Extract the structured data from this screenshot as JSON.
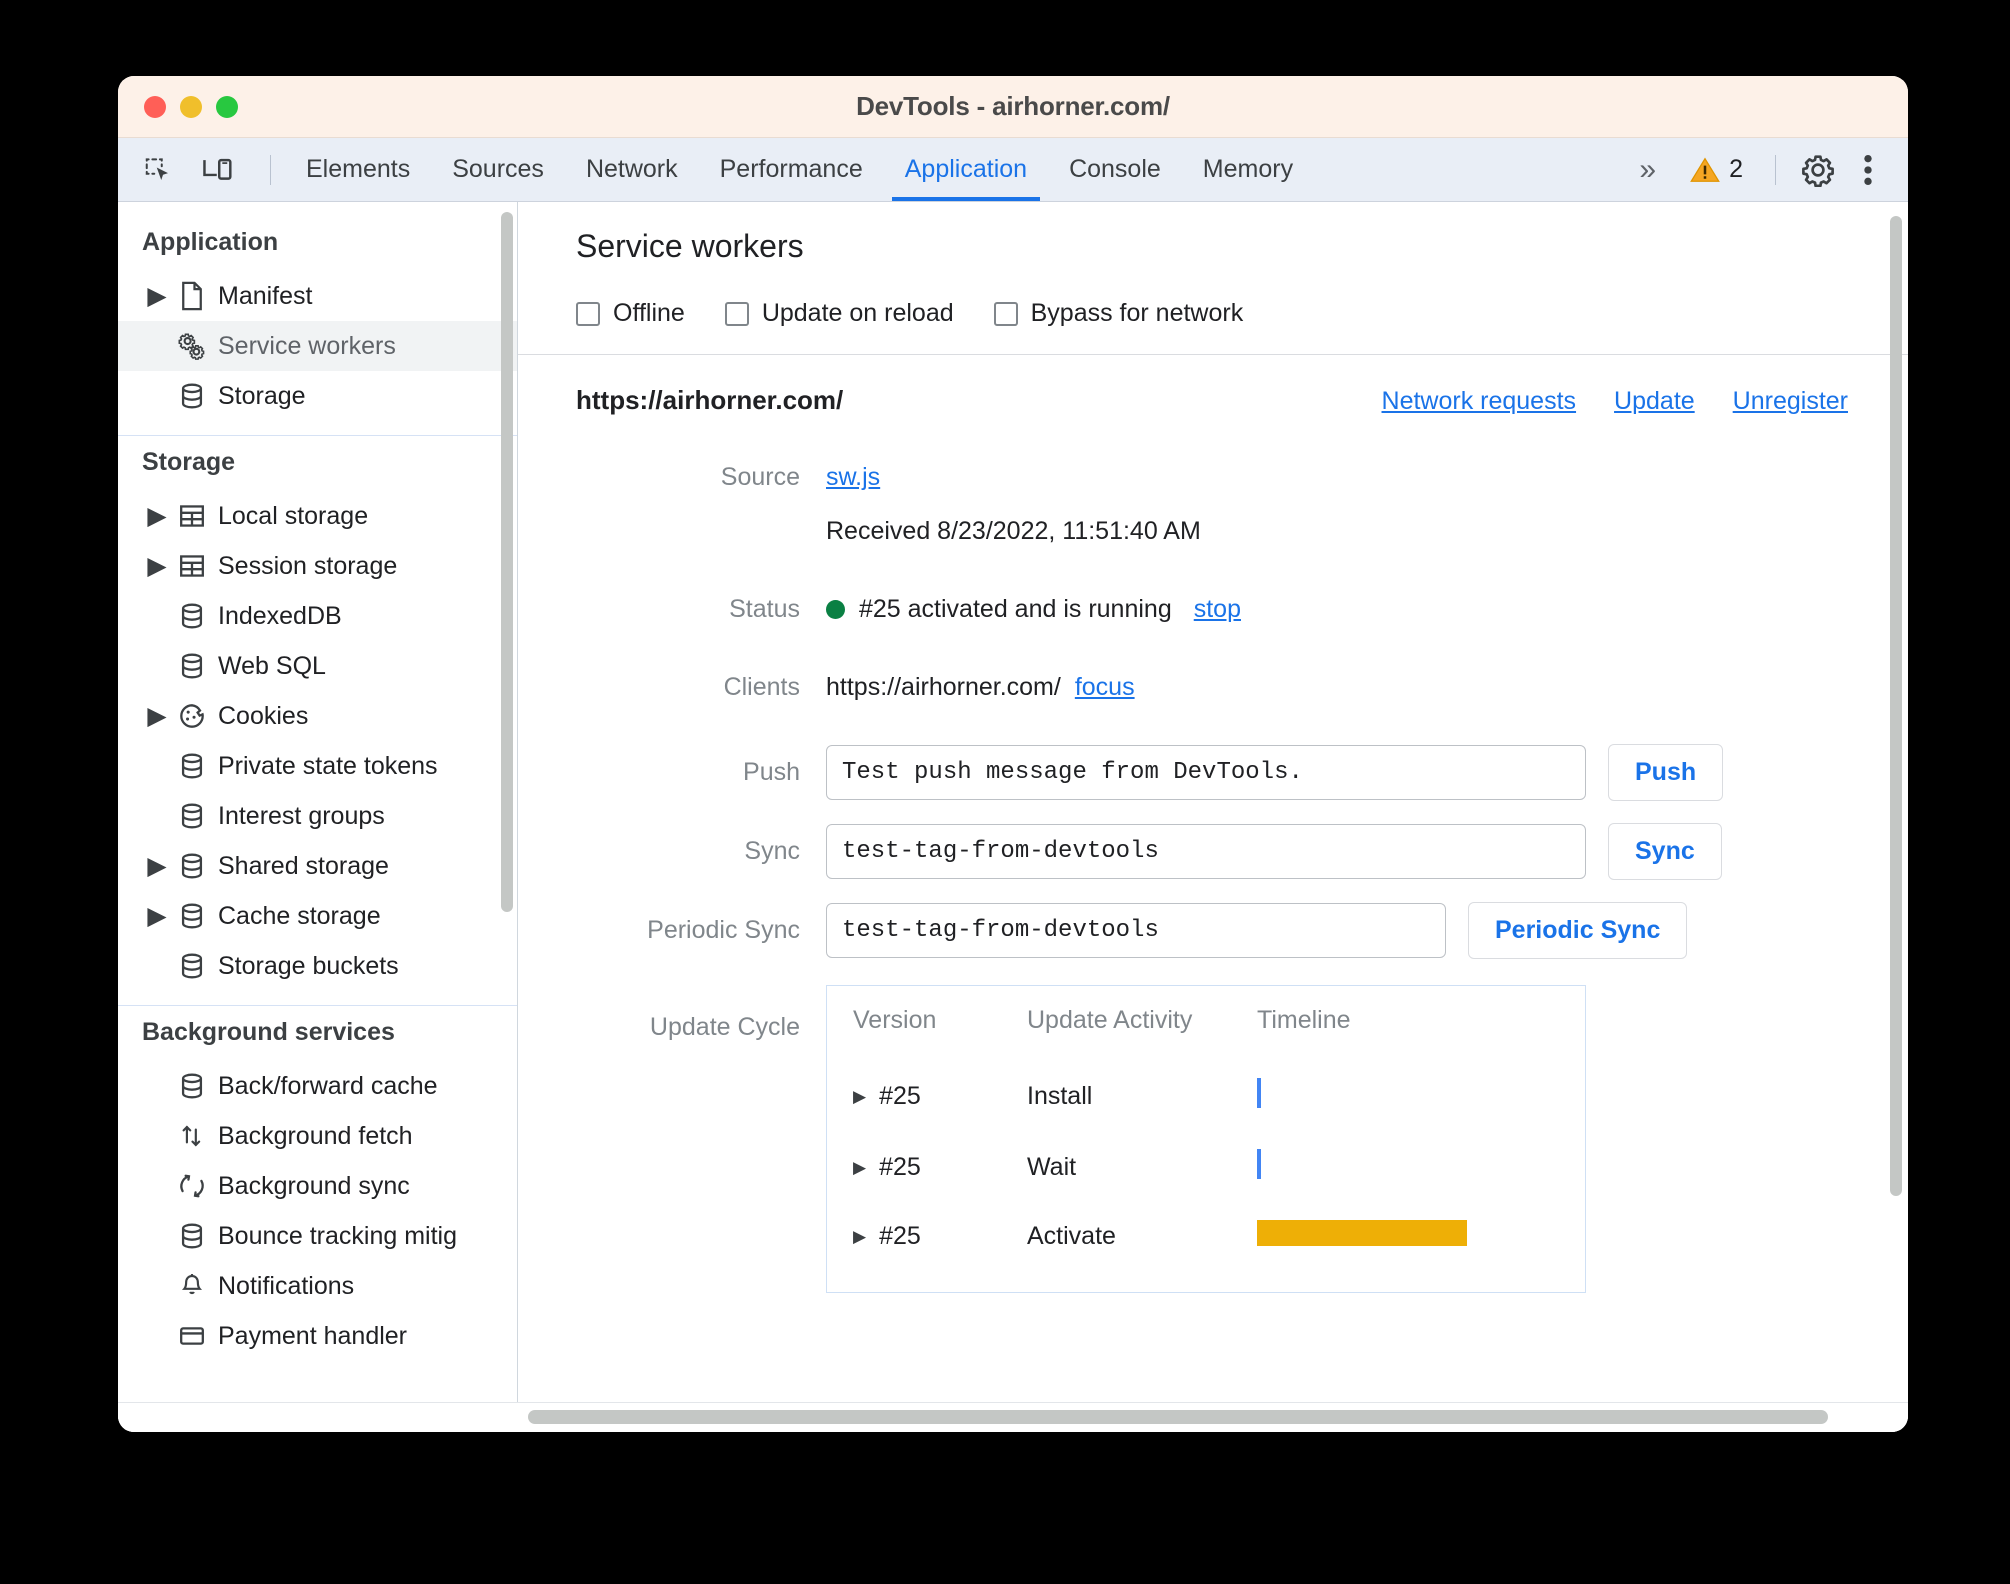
{
  "window": {
    "title": "DevTools - airhorner.com/",
    "traffic_lights": [
      "close-red",
      "minimize-yellow",
      "maximize-green"
    ]
  },
  "toolbar": {
    "inspect_icon": "inspect-element-icon",
    "device_icon": "device-toolbar-icon",
    "tabs": [
      {
        "label": "Elements",
        "active": false
      },
      {
        "label": "Sources",
        "active": false
      },
      {
        "label": "Network",
        "active": false
      },
      {
        "label": "Performance",
        "active": false
      },
      {
        "label": "Application",
        "active": true
      },
      {
        "label": "Console",
        "active": false
      },
      {
        "label": "Memory",
        "active": false
      }
    ],
    "more_tabs": "»",
    "warning_icon": "warning-triangle-icon",
    "warning_count": "2",
    "settings_icon": "gear-icon",
    "menu_icon": "vertical-dots-icon"
  },
  "sidebar": {
    "groups": [
      {
        "title": "Application",
        "items": [
          {
            "label": "Manifest",
            "icon": "document-icon",
            "arrow": true,
            "selected": false
          },
          {
            "label": "Service workers",
            "icon": "gears-icon",
            "arrow": false,
            "selected": true
          },
          {
            "label": "Storage",
            "icon": "database-icon",
            "arrow": false,
            "selected": false
          }
        ]
      },
      {
        "title": "Storage",
        "items": [
          {
            "label": "Local storage",
            "icon": "table-icon",
            "arrow": true,
            "selected": false
          },
          {
            "label": "Session storage",
            "icon": "table-icon",
            "arrow": true,
            "selected": false
          },
          {
            "label": "IndexedDB",
            "icon": "database-icon",
            "arrow": false,
            "selected": false
          },
          {
            "label": "Web SQL",
            "icon": "database-icon",
            "arrow": false,
            "selected": false
          },
          {
            "label": "Cookies",
            "icon": "cookie-icon",
            "arrow": true,
            "selected": false
          },
          {
            "label": "Private state tokens",
            "icon": "database-icon",
            "arrow": false,
            "selected": false
          },
          {
            "label": "Interest groups",
            "icon": "database-icon",
            "arrow": false,
            "selected": false
          },
          {
            "label": "Shared storage",
            "icon": "database-icon",
            "arrow": true,
            "selected": false
          },
          {
            "label": "Cache storage",
            "icon": "database-icon",
            "arrow": true,
            "selected": false
          },
          {
            "label": "Storage buckets",
            "icon": "database-icon",
            "arrow": false,
            "selected": false
          }
        ]
      },
      {
        "title": "Background services",
        "items": [
          {
            "label": "Back/forward cache",
            "icon": "database-icon",
            "arrow": false,
            "selected": false
          },
          {
            "label": "Background fetch",
            "icon": "updown-arrows-icon",
            "arrow": false,
            "selected": false
          },
          {
            "label": "Background sync",
            "icon": "sync-arrows-icon",
            "arrow": false,
            "selected": false
          },
          {
            "label": "Bounce tracking mitig",
            "icon": "database-icon",
            "arrow": false,
            "selected": false
          },
          {
            "label": "Notifications",
            "icon": "bell-icon",
            "arrow": false,
            "selected": false
          },
          {
            "label": "Payment handler",
            "icon": "card-icon",
            "arrow": false,
            "selected": false
          }
        ]
      }
    ]
  },
  "main": {
    "title": "Service workers",
    "checkboxes": [
      {
        "label": "Offline",
        "checked": false
      },
      {
        "label": "Update on reload",
        "checked": false
      },
      {
        "label": "Bypass for network",
        "checked": false
      }
    ],
    "origin": "https://airhorner.com/",
    "header_links": [
      "Network requests",
      "Update",
      "Unregister"
    ],
    "fields": {
      "source_label": "Source",
      "source_value": "sw.js",
      "received": "Received 8/23/2022, 11:51:40 AM",
      "status_label": "Status",
      "status_value": "#25 activated and is running",
      "status_action": "stop",
      "status_color": "#0a8043",
      "clients_label": "Clients",
      "clients_value": "https://airhorner.com/",
      "clients_action": "focus",
      "push_label": "Push",
      "push_value": "Test push message from DevTools.",
      "push_button": "Push",
      "sync_label": "Sync",
      "sync_value": "test-tag-from-devtools",
      "sync_button": "Sync",
      "periodic_label": "Periodic Sync",
      "periodic_value": "test-tag-from-devtools",
      "periodic_button": "Periodic Sync"
    },
    "update_cycle": {
      "label": "Update Cycle",
      "columns": [
        "Version",
        "Update Activity",
        "Timeline"
      ],
      "rows": [
        {
          "version": "#25",
          "activity": "Install",
          "timeline": "thin",
          "color": "#4285f4"
        },
        {
          "version": "#25",
          "activity": "Wait",
          "timeline": "thin",
          "color": "#4285f4"
        },
        {
          "version": "#25",
          "activity": "Activate",
          "timeline": "wide",
          "color": "#eeaf06"
        }
      ]
    }
  }
}
